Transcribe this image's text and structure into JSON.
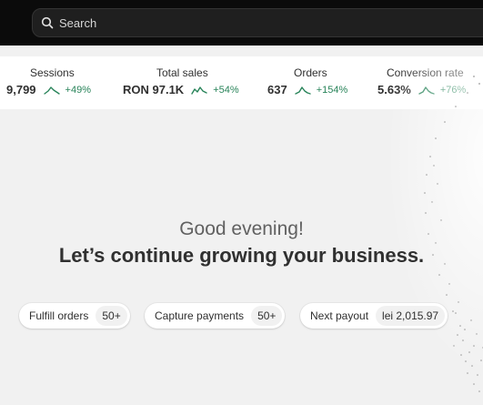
{
  "search": {
    "placeholder": "Search"
  },
  "metrics": [
    {
      "label": "Sessions",
      "value": "9,799",
      "change": "+49%"
    },
    {
      "label": "Total sales",
      "value": "RON 97.1K",
      "change": "+54%"
    },
    {
      "label": "Orders",
      "value": "637",
      "change": "+154%"
    },
    {
      "label": "Conversion rate",
      "value": "5.63%",
      "change": "+76%"
    }
  ],
  "greeting": {
    "line1": "Good evening!",
    "line2": "Let’s continue growing your business."
  },
  "actions": [
    {
      "label": "Fulfill orders",
      "count": "50+"
    },
    {
      "label": "Capture payments",
      "count": "50+"
    },
    {
      "label": "Next payout",
      "count": "lei 2,015.97"
    }
  ],
  "colors": {
    "topbar": "#0b0b0b",
    "positive_change": "#29845a",
    "page_background": "#f1f1f1"
  }
}
